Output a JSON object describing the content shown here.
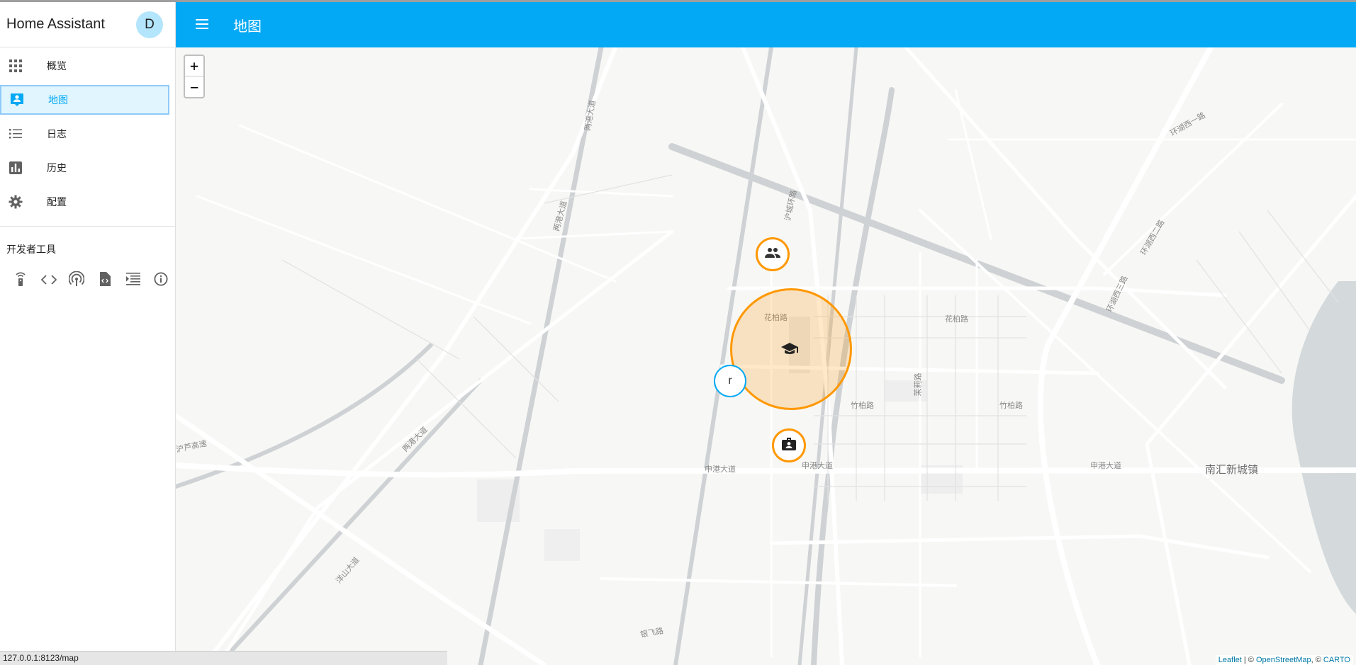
{
  "app": {
    "title": "Home Assistant",
    "user_initial": "D"
  },
  "sidebar": {
    "items": [
      {
        "label": "概览",
        "icon": "grid-icon"
      },
      {
        "label": "地图",
        "icon": "map-account-icon",
        "active": true
      },
      {
        "label": "日志",
        "icon": "list-icon"
      },
      {
        "label": "历史",
        "icon": "chart-icon"
      },
      {
        "label": "配置",
        "icon": "gear-icon"
      }
    ],
    "dev_tools_title": "开发者工具",
    "dev_tools": [
      "remote-icon",
      "code-icon",
      "broadcast-icon",
      "file-code-icon",
      "log-icon",
      "info-icon"
    ]
  },
  "toolbar": {
    "title": "地图"
  },
  "map": {
    "zoom_in": "+",
    "zoom_out": "−",
    "person_marker": "r",
    "road_labels": [
      "沪城环路",
      "花柏路",
      "花柏路",
      "竹柏路",
      "竹柏路",
      "申港大道",
      "申港大道",
      "申港大道",
      "两港大道",
      "两港大道",
      "两港大道",
      "环湖西三路",
      "环湖西二路",
      "环湖西一路",
      "沪芦高速",
      "洋山大道",
      "南汇新城镇",
      "银飞路",
      "茉莉路"
    ],
    "attribution": {
      "leaflet": "Leaflet",
      "sep1": " | © ",
      "osm": "OpenStreetMap",
      "sep2": ", © ",
      "carto": "CARTO"
    }
  },
  "status_bar": {
    "url": "127.0.0.1:8123/map"
  },
  "colors": {
    "accent": "#03a9f4",
    "zone": "#ff9800",
    "sidebar_active_bg": "#e1f5fe"
  }
}
